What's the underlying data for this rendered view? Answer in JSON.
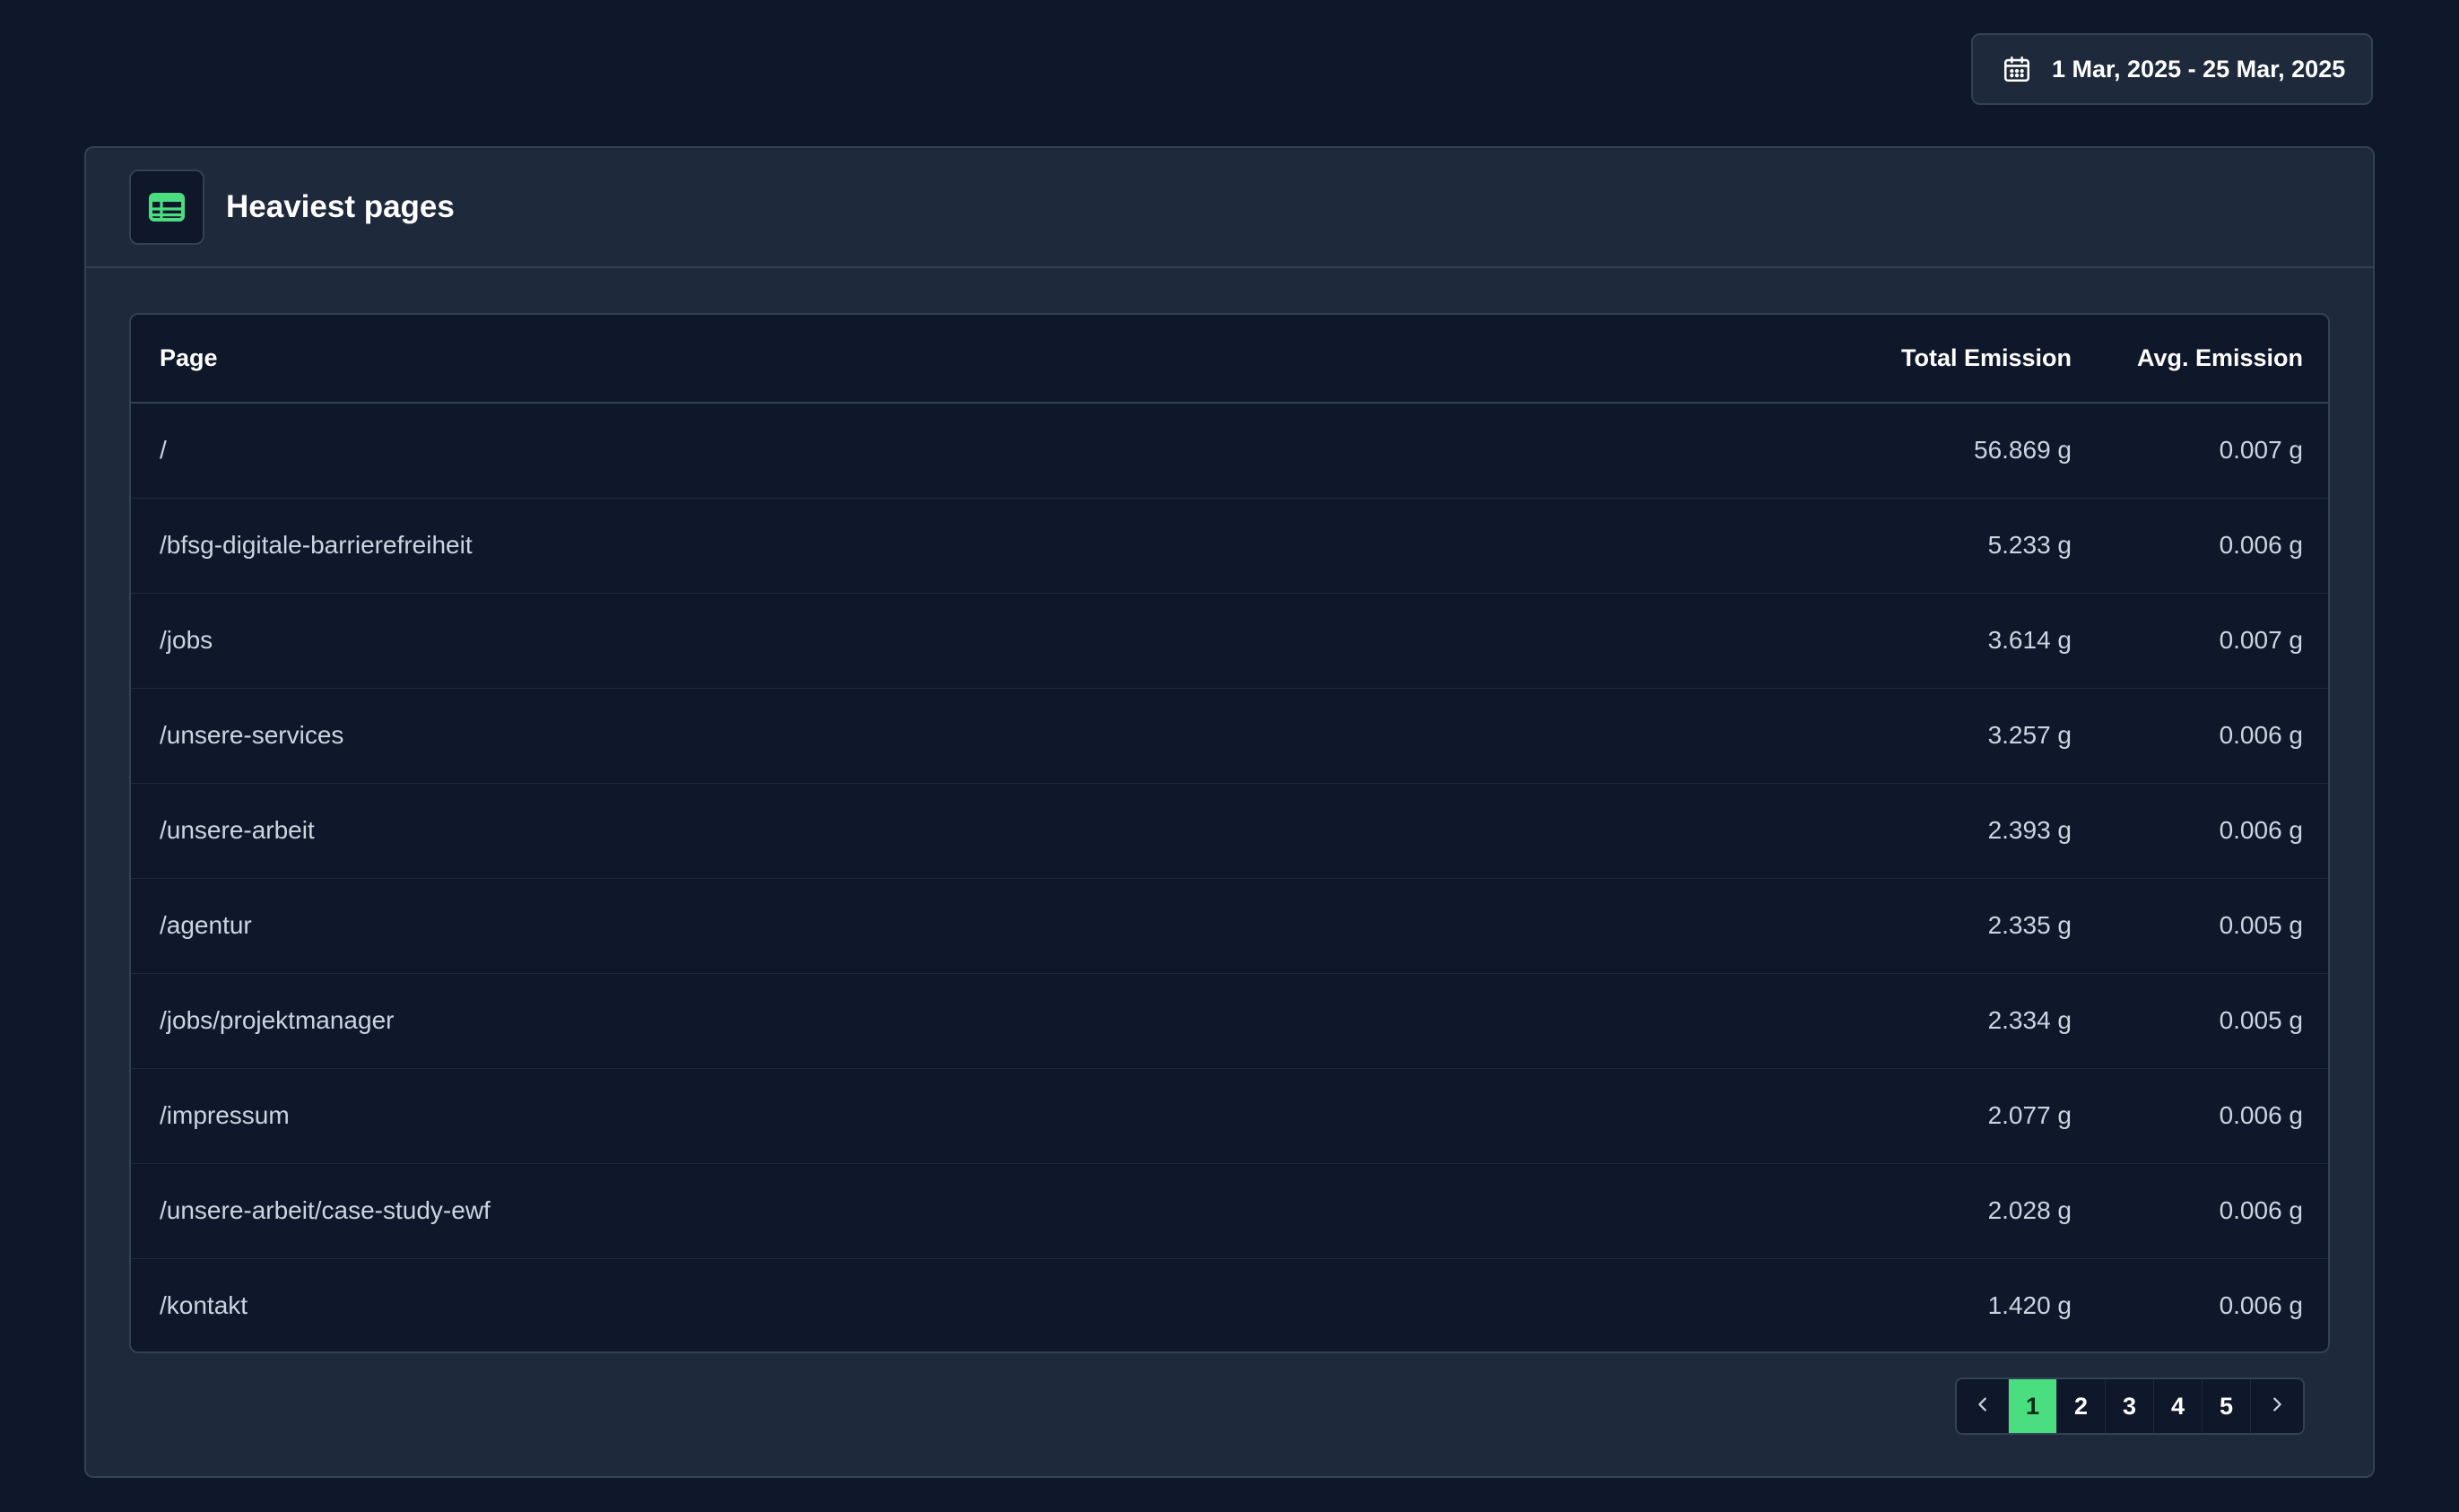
{
  "date_range": {
    "label": "1 Mar, 2025 - 25 Mar, 2025",
    "icon": "calendar-icon"
  },
  "card": {
    "title": "Heaviest pages",
    "icon": "table-icon",
    "icon_color": "#4ade80"
  },
  "table": {
    "headers": {
      "page": "Page",
      "total": "Total Emission",
      "avg": "Avg. Emission"
    },
    "rows": [
      {
        "page": "/",
        "total": "56.869 g",
        "avg": "0.007 g"
      },
      {
        "page": "/bfsg-digitale-barrierefreiheit",
        "total": "5.233 g",
        "avg": "0.006 g"
      },
      {
        "page": "/jobs",
        "total": "3.614 g",
        "avg": "0.007 g"
      },
      {
        "page": "/unsere-services",
        "total": "3.257 g",
        "avg": "0.006 g"
      },
      {
        "page": "/unsere-arbeit",
        "total": "2.393 g",
        "avg": "0.006 g"
      },
      {
        "page": "/agentur",
        "total": "2.335 g",
        "avg": "0.005 g"
      },
      {
        "page": "/jobs/projektmanager",
        "total": "2.334 g",
        "avg": "0.005 g"
      },
      {
        "page": "/impressum",
        "total": "2.077 g",
        "avg": "0.006 g"
      },
      {
        "page": "/unsere-arbeit/case-study-ewf",
        "total": "2.028 g",
        "avg": "0.006 g"
      },
      {
        "page": "/kontakt",
        "total": "1.420 g",
        "avg": "0.006 g"
      }
    ]
  },
  "pagination": {
    "pages": [
      "1",
      "2",
      "3",
      "4",
      "5"
    ],
    "current": "1",
    "prev_icon": "chevron-left-icon",
    "next_icon": "chevron-right-icon",
    "accent_color": "#4ade80"
  }
}
